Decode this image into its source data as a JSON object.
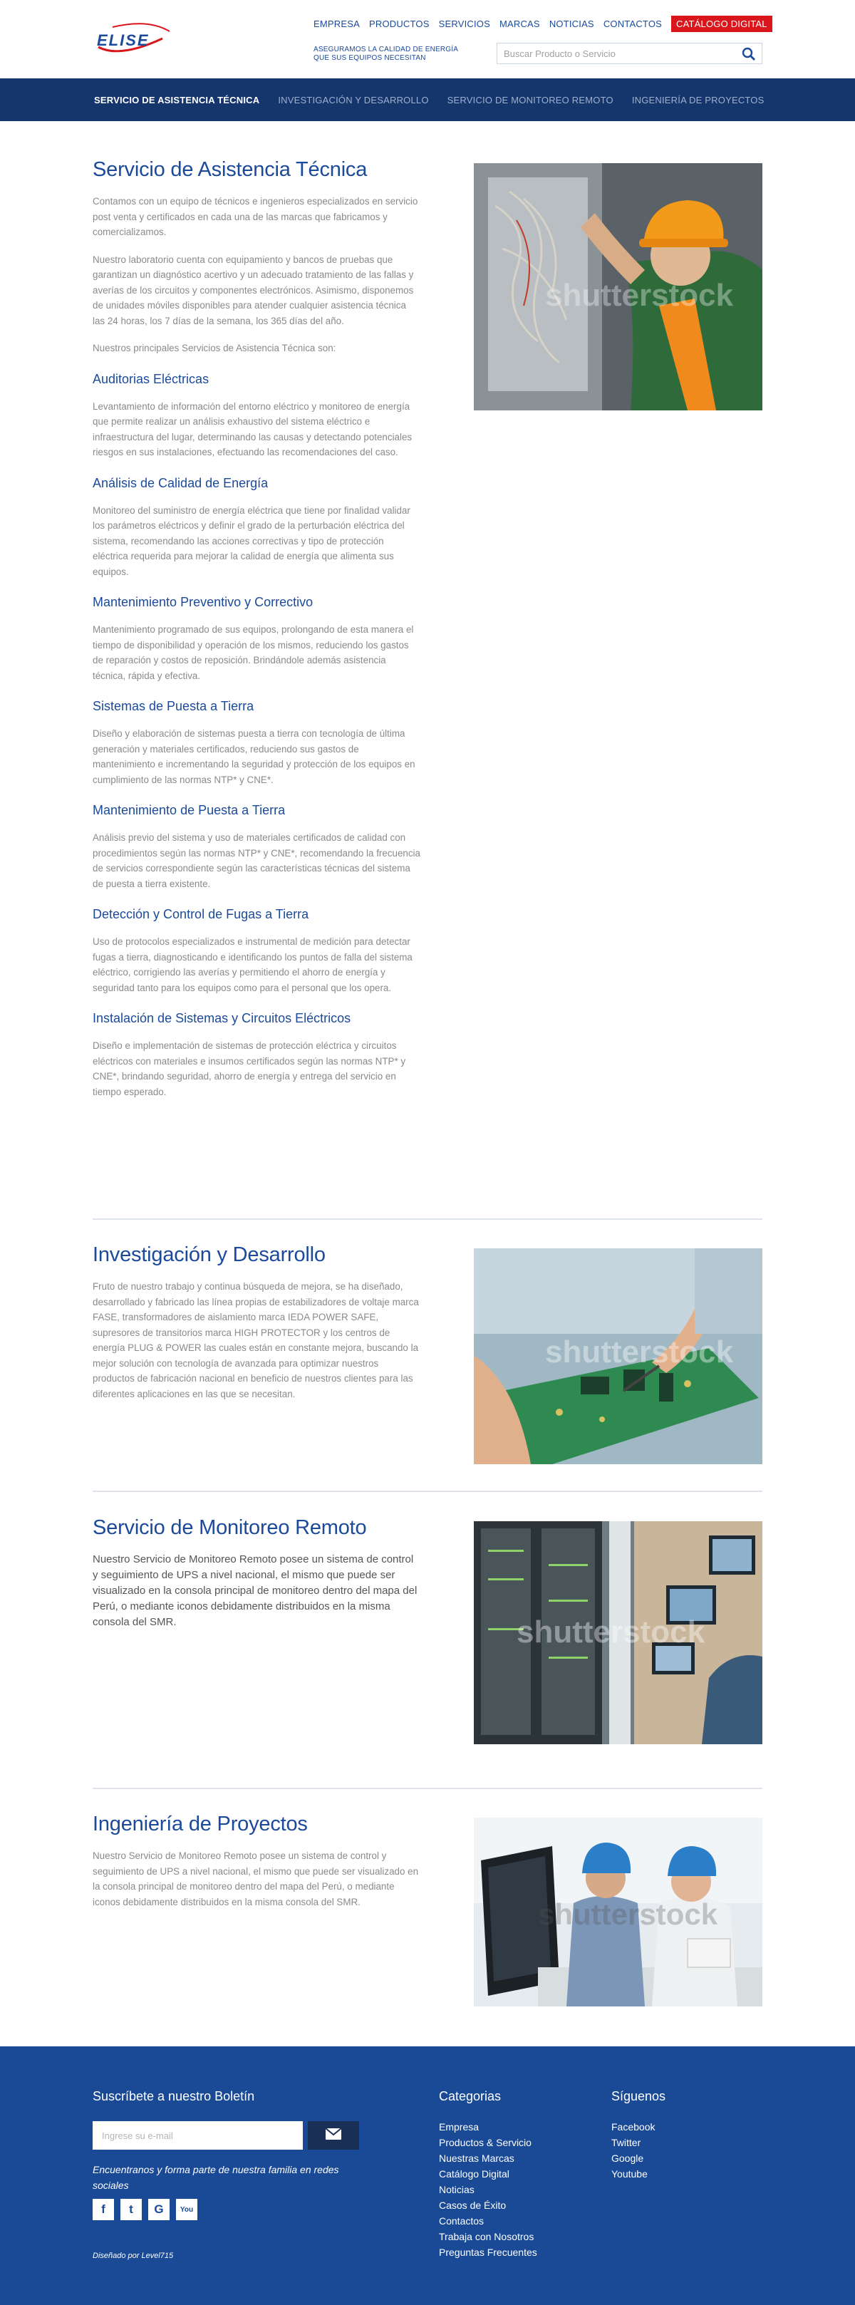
{
  "header": {
    "logo_text": "ELISE",
    "nav": [
      "EMPRESA",
      "PRODUCTOS",
      "SERVICIOS",
      "MARCAS",
      "NOTICIAS",
      "CONTACTOS"
    ],
    "catalog": "CATÁLOGO DIGITAL",
    "tagline_1": "ASEGURAMOS LA CALIDAD DE ENERGÍA",
    "tagline_2": "QUE SUS EQUIPOS NECESITAN",
    "search_placeholder": "Buscar Producto o Servicio"
  },
  "subnav": [
    "SERVICIO DE ASISTENCIA TÉCNICA",
    "INVESTIGACIÓN Y DESARROLLO",
    "SERVICIO DE MONITOREO REMOTO",
    "INGENIERÍA DE PROYECTOS"
  ],
  "watermark": "shutterstock",
  "asistencia": {
    "title": "Servicio de Asistencia Técnica",
    "p1": "Contamos con un equipo de técnicos e ingenieros especializados en servicio post venta y certificados en cada una de las marcas que fabricamos y comercializamos.",
    "p2": "Nuestro laboratorio cuenta con equipamiento y bancos de pruebas que garantizan un diagnóstico acertivo y un adecuado tratamiento de las fallas y averías de los circuitos y componentes electrónicos. Asimismo, disponemos de unidades móviles disponibles para atender cualquier asistencia técnica las 24 horas, los 7 días de la semana, los 365 días del año.",
    "p3": "Nuestros principales Servicios de Asistencia Técnica son:",
    "items": [
      {
        "title": "Auditorias Eléctricas",
        "text": "Levantamiento de información del entorno eléctrico y monitoreo de energía que permite realizar un análisis exhaustivo del sistema eléctrico e infraestructura del lugar, determinando las causas y detectando potenciales riesgos en sus instalaciones, efectuando las recomendaciones del caso."
      },
      {
        "title": "Análisis de Calidad de Energía",
        "text": "Monitoreo del suministro de energía eléctrica que tiene por finalidad validar los parámetros eléctricos y definir el grado de la perturbación eléctrica del sistema, recomendando las acciones correctivas y tipo de protección eléctrica requerida para mejorar la calidad de energía que alimenta sus equipos."
      },
      {
        "title": "Mantenimiento Preventivo y Correctivo",
        "text": "Mantenimiento programado de sus equipos, prolongando de esta manera el tiempo de disponibilidad y operación de los mismos, reduciendo los gastos de reparación y costos de reposición. Brindándole además asistencia técnica, rápida y efectiva."
      },
      {
        "title": "Sistemas de Puesta a Tierra",
        "text": "Diseño y elaboración de sistemas puesta a tierra con tecnología de última generación y materiales certificados, reduciendo sus gastos de mantenimiento e incrementando la seguridad y protección de los equipos en cumplimiento de las normas NTP* y CNE*."
      },
      {
        "title": "Mantenimiento de Puesta a Tierra",
        "text": "Análisis previo del sistema y uso de materiales certificados de calidad con procedimientos según las normas NTP* y CNE*, recomendando la frecuencia de servicios correspondiente según las características técnicas del sistema de puesta a tierra existente."
      },
      {
        "title": "Detección y Control de Fugas a Tierra",
        "text": "Uso de protocolos especializados e instrumental de medición para detectar fugas a tierra, diagnosticando e identificando los puntos de falla del sistema eléctrico, corrigiendo las averías y permitiendo el ahorro de energía y seguridad tanto para los equipos como para el personal que los opera."
      },
      {
        "title": "Instalación de Sistemas y Circuitos Eléctricos",
        "text": "Diseño e implementación de sistemas de protección eléctrica y circuitos eléctricos con materiales e insumos certificados según las normas NTP* y CNE*, brindando seguridad, ahorro de energía y entrega del servicio en tiempo esperado."
      }
    ]
  },
  "investigacion": {
    "title": "Investigación y Desarrollo",
    "text": "Fruto de nuestro trabajo y continua búsqueda de mejora, se ha diseñado, desarrollado y fabricado las línea propias de estabilizadores de voltaje marca FASE, transformadores de aislamiento marca IEDA POWER SAFE, supresores de transitorios marca HIGH PROTECTOR y los centros de energía PLUG & POWER las cuales están en constante mejora, buscando la mejor solución con tecnología de avanzada para optimizar nuestros productos de fabricación nacional en beneficio de nuestros clientes para las diferentes aplicaciones en las que se necesitan."
  },
  "monitoreo": {
    "title": "Servicio de Monitoreo Remoto",
    "text": "Nuestro Servicio de Monitoreo Remoto posee un sistema de control y seguimiento de UPS a nivel nacional, el mismo que puede ser visualizado en la consola principal de monitoreo dentro del mapa del Perú, o mediante iconos debidamente distribuidos en la misma consola del SMR."
  },
  "ingenieria": {
    "title": "Ingeniería de Proyectos",
    "text": "Nuestro Servicio de Monitoreo Remoto posee un sistema de control y seguimiento de UPS a nivel nacional, el mismo que puede ser visualizado en la consola principal de monitoreo dentro del mapa del Perú, o mediante iconos debidamente distribuidos en la misma consola del SMR."
  },
  "footer": {
    "newsletter_title": "Suscríbete a nuestro Boletín",
    "email_placeholder": "Ingrese su e-mail",
    "tagline": "Encuentranos y forma parte de nuestra familia en redes sociales",
    "designed": "Diseñado por Level715",
    "categories_title": "Categorias",
    "categories": [
      "Empresa",
      "Productos & Servicio",
      "Nuestras Marcas",
      "Catálogo Digital",
      "Noticias",
      "Casos de Éxito",
      "Contactos",
      "Trabaja con Nosotros",
      "Preguntas Frecuentes"
    ],
    "follow_title": "Síguenos",
    "follow": [
      "Facebook",
      "Twitter",
      "Google",
      "Youtube"
    ],
    "social_glyphs": [
      "f",
      "t",
      "G",
      "You"
    ]
  },
  "colors": {
    "brand_blue": "#1b4a9a",
    "navy": "#14366d",
    "red": "#d9161c",
    "footer": "#1a4a96"
  }
}
